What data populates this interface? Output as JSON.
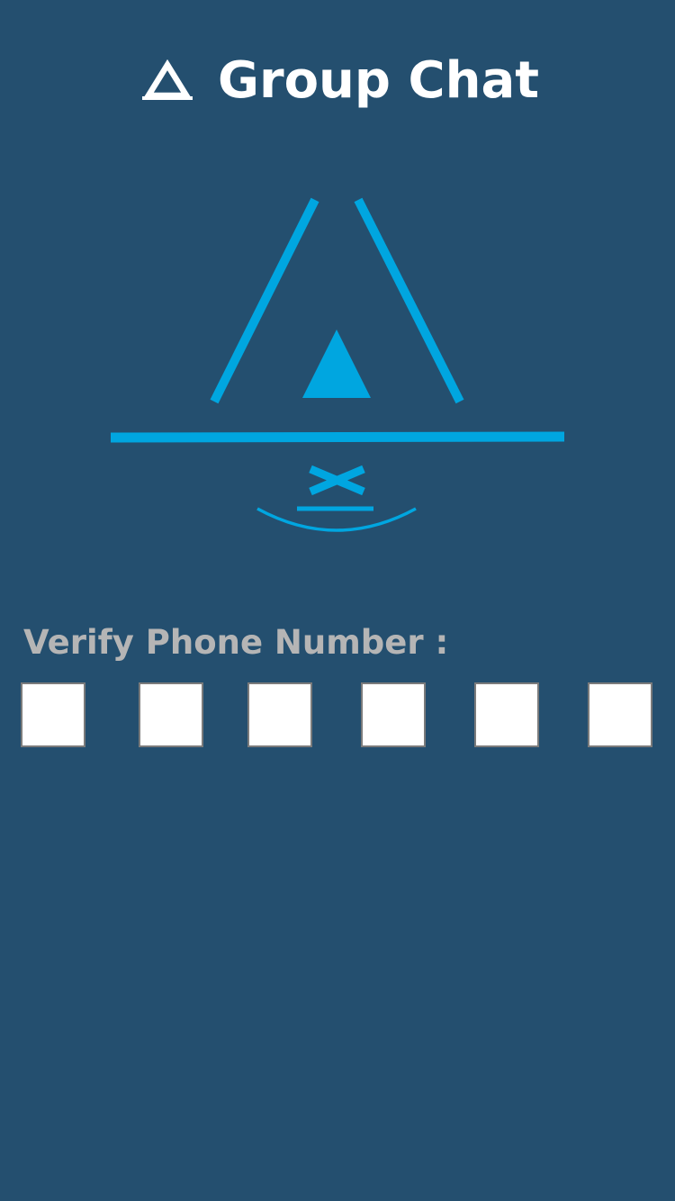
{
  "header": {
    "title": "Group Chat",
    "icon": "triangle-logo-icon"
  },
  "logo": {
    "icon": "group-chat-emblem-icon",
    "color": "#00a6e0"
  },
  "verify": {
    "label": "Verify Phone Number :",
    "code_length": 6,
    "digits": [
      "",
      "",
      "",
      "",
      "",
      ""
    ]
  },
  "colors": {
    "background": "#244f6f",
    "accent": "#00a6e0",
    "title": "#ffffff",
    "label": "#b5b5b5",
    "box_border": "#7b7b7b"
  }
}
